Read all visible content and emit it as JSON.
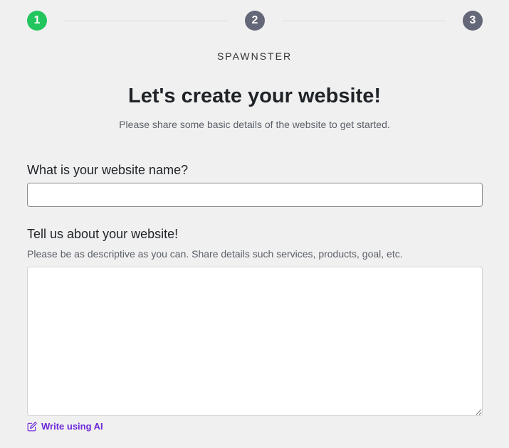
{
  "stepper": {
    "steps": [
      {
        "number": "1",
        "state": "active"
      },
      {
        "number": "2",
        "state": "inactive"
      },
      {
        "number": "3",
        "state": "inactive"
      }
    ]
  },
  "colors": {
    "active_step": "#22c55e",
    "inactive_step": "#636778",
    "accent_link": "#6d28d9",
    "background": "#f0f0f0"
  },
  "brand": "SPAWNSTER",
  "header": {
    "title": "Let's create your website!",
    "subtitle": "Please share some basic details of the website to get started."
  },
  "form": {
    "website_name": {
      "label": "What is your website name?",
      "value": "",
      "placeholder": ""
    },
    "about": {
      "label": "Tell us about your website!",
      "hint": "Please be as descriptive as you can. Share details such services, products, goal, etc.",
      "value": "",
      "placeholder": ""
    },
    "ai_link": {
      "icon": "edit-icon",
      "label": "Write using AI"
    }
  }
}
